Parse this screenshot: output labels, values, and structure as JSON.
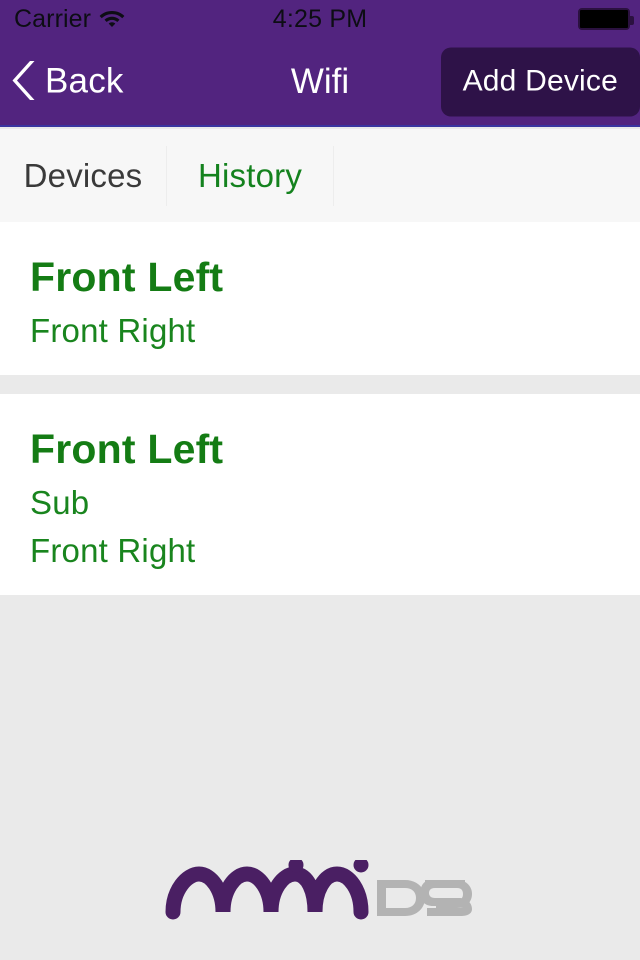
{
  "status_bar": {
    "carrier": "Carrier",
    "wifi_icon": "wifi-icon",
    "time": "4:25 PM",
    "battery_icon": "battery-full-icon"
  },
  "nav_bar": {
    "back_icon": "chevron-left-icon",
    "back_label": "Back",
    "title": "Wifi",
    "add_device_label": "Add Device",
    "background_color": "#52247f",
    "button_color": "#2e1248"
  },
  "tabs": [
    {
      "label": "Devices",
      "selected": false,
      "color": "#3a3a3a"
    },
    {
      "label": "History",
      "selected": true,
      "color": "#14821e"
    }
  ],
  "history": {
    "cards": [
      {
        "title": "Front Left",
        "lines": [
          "Front Right"
        ]
      },
      {
        "title": "Front Left",
        "lines": [
          "Sub",
          "Front Right"
        ]
      }
    ]
  },
  "footer": {
    "logo_icon": "minidsp-logo",
    "logo_text_primary": "mini",
    "logo_text_secondary": "DSP",
    "logo_primary_color": "#4a1f63",
    "logo_secondary_color": "#b3b3b3"
  },
  "theme": {
    "accent_purple": "#52247f",
    "accent_green": "#14821e",
    "page_background": "#eaeaea",
    "card_background": "#ffffff"
  }
}
